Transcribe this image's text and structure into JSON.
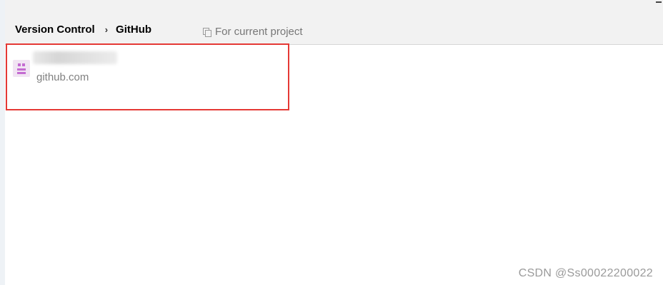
{
  "breadcrumb": {
    "items": [
      "Version Control",
      "GitHub"
    ],
    "separator": "›"
  },
  "scope": {
    "label": "For current project",
    "icon": "copy-icon"
  },
  "account": {
    "server": "github.com",
    "avatar_icon": "identicon-avatar",
    "username_redacted": true
  },
  "watermark": "CSDN @Ss00022200022",
  "colors": {
    "highlight_border": "#e53935",
    "avatar": "#c46bd1",
    "header_bg": "#f2f2f2"
  }
}
